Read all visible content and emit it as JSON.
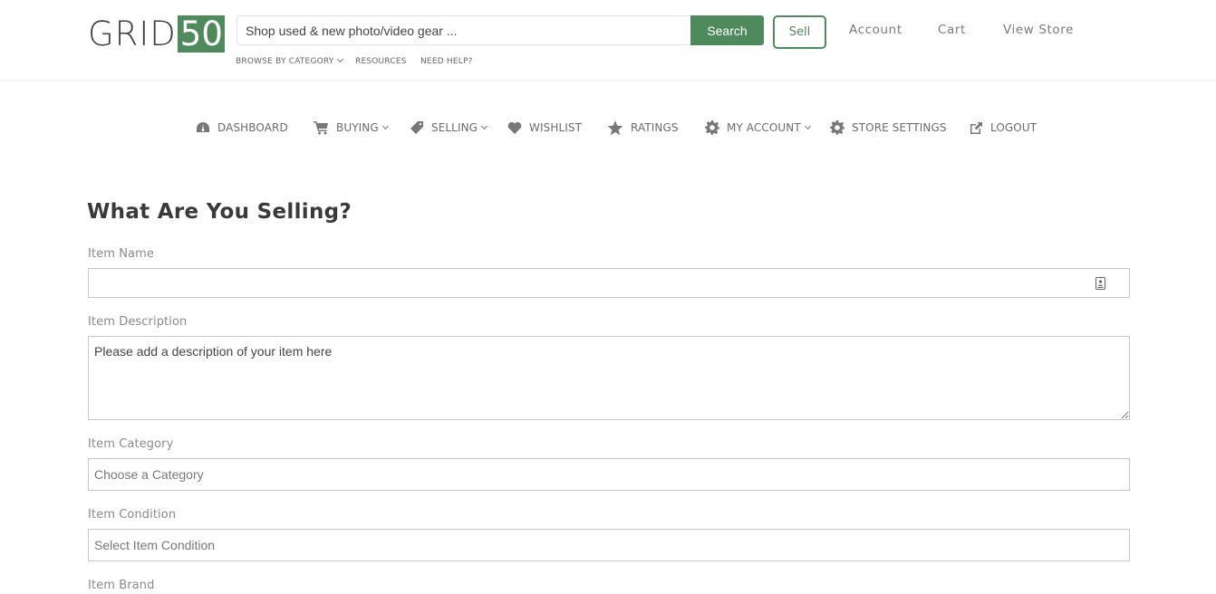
{
  "header": {
    "logo_word": "GRID",
    "logo_number": "50",
    "search_placeholder": "Shop used & new photo/video gear ...",
    "search_button": "Search",
    "sell_button": "Sell",
    "account_link": "Account",
    "cart_link": "Cart",
    "view_store_link": "View Store",
    "sub_links": {
      "browse": "BROWSE BY CATEGORY",
      "resources": "RESOURCES",
      "help": "NEED HELP?"
    }
  },
  "nav": {
    "dashboard": "DASHBOARD",
    "buying": "BUYING",
    "selling": "SELLING",
    "wishlist": "WISHLIST",
    "ratings": "RATINGS",
    "my_account": "MY ACCOUNT",
    "store_settings": "STORE SETTINGS",
    "logout": "LOGOUT"
  },
  "form": {
    "title": "What Are You Selling?",
    "item_name": {
      "label": "Item Name",
      "value": ""
    },
    "item_description": {
      "label": "Item Description",
      "placeholder": "Please add a description of your item here"
    },
    "item_category": {
      "label": "Item Category",
      "selected": "Choose a Category"
    },
    "item_condition": {
      "label": "Item Condition",
      "selected": "Select Item Condition"
    },
    "item_brand": {
      "label": "Item Brand"
    }
  },
  "colors": {
    "brand_green": "#4f8a5d",
    "text_dark": "#3a3a3a",
    "text_muted": "#8a8a8a",
    "border": "#c6c6c6"
  },
  "icons": {
    "dashboard": "dashboard-gauge-icon",
    "buying": "shopping-cart-icon",
    "selling": "price-tag-icon",
    "wishlist": "heart-icon",
    "ratings": "star-icon",
    "my_account": "gear-icon",
    "store_settings": "gear-icon",
    "logout": "external-link-icon"
  }
}
